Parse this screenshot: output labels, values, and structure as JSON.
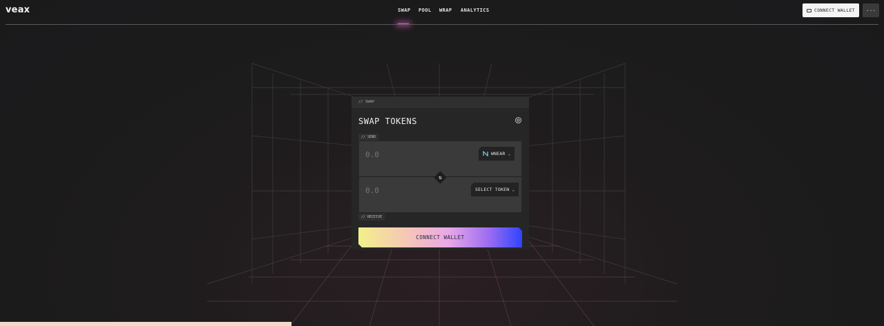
{
  "header": {
    "logo": "veax",
    "nav": [
      "SWAP",
      "POOL",
      "WRAP",
      "ANALYTICS"
    ],
    "active_nav": "SWAP",
    "connect_wallet": "CONNECT WALLET",
    "more": "···"
  },
  "swap_card": {
    "tab_label": "// SWAP",
    "title": "SWAP TOKENS",
    "send_label": "// SEND",
    "receive_label": "// RECEIVE",
    "send_amount_placeholder": "0.0",
    "receive_amount_placeholder": "0.0",
    "send_token": "WNEAR",
    "receive_token": "SELECT TOKEN",
    "swap_direction_icon": "⇅",
    "connect_button": "CONNECT WALLET"
  },
  "toast": {
    "text": ""
  },
  "colors": {
    "accent_start": "#f3f08a",
    "accent_end": "#2e44ff",
    "nav_indicator": "#e060c8",
    "card_bg": "#262627"
  },
  "icons": [
    "wallet-icon",
    "gear-icon",
    "near-logo-icon",
    "chevron-down-icon",
    "swap-arrows-icon",
    "more-icon"
  ]
}
